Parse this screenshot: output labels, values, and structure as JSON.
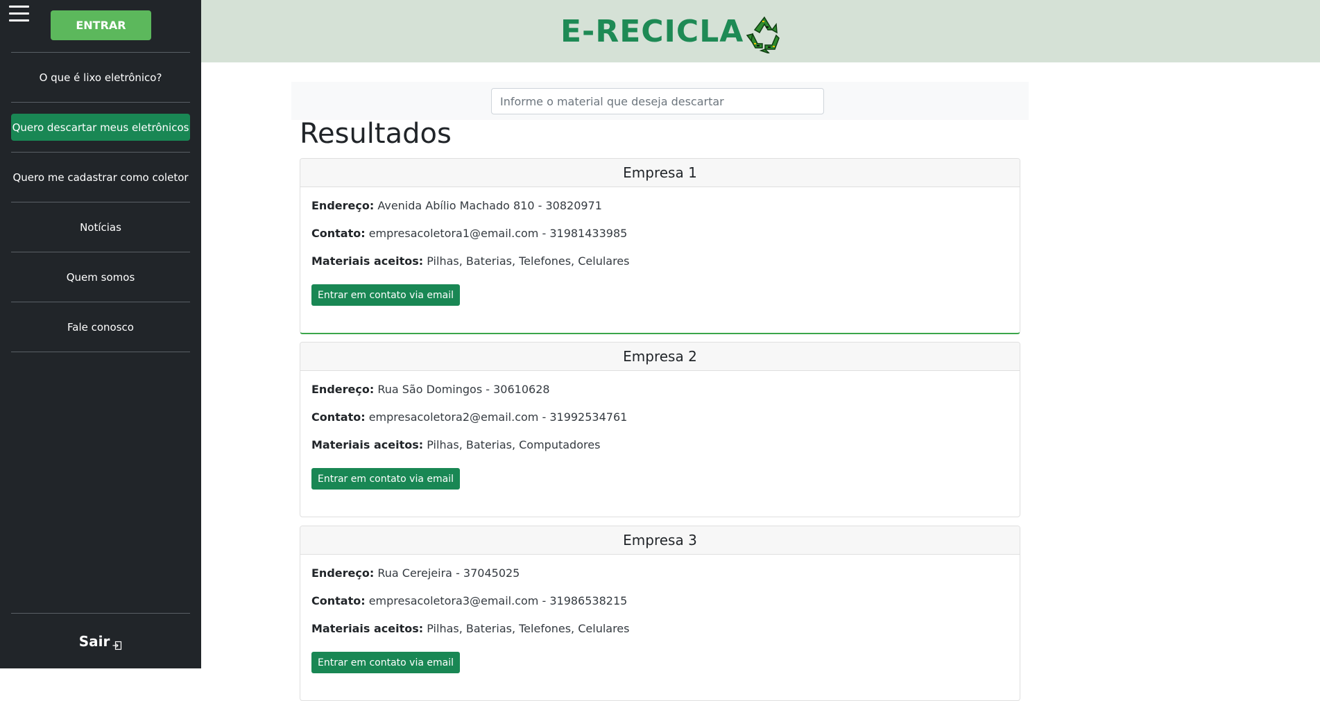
{
  "sidebar": {
    "enter_label": "ENTRAR",
    "items": [
      {
        "label": "O que é lixo eletrônico?"
      },
      {
        "label": "Quero descartar meus eletrônicos"
      },
      {
        "label": "Quero me cadastrar como coletor"
      },
      {
        "label": "Notícias"
      },
      {
        "label": "Quem somos"
      },
      {
        "label": "Fale conosco"
      }
    ],
    "active_item": "Quero descartar meus eletrônicos",
    "logout_label": "Sair"
  },
  "header": {
    "brand": "E-RECICLA"
  },
  "search": {
    "placeholder": "Informe o material que deseja descartar",
    "value": ""
  },
  "results": {
    "title": "Resultados",
    "address_label": "Endereço:",
    "contact_label": "Contato:",
    "materials_label": "Materiais aceitos:",
    "button_label": "Entrar em contato via email",
    "companies": [
      {
        "name": "Empresa 1",
        "address": "Avenida Abílio Machado 810 - 30820971",
        "contact": "empresacoletora1@email.com - 31981433985",
        "materials": "Pilhas, Baterias, Telefones, Celulares"
      },
      {
        "name": "Empresa 2",
        "address": "Rua São Domingos - 30610628",
        "contact": "empresacoletora2@email.com - 31992534761",
        "materials": "Pilhas, Baterias, Computadores"
      },
      {
        "name": "Empresa 3",
        "address": "Rua Cerejeira - 37045025",
        "contact": "empresacoletora3@email.com - 31986538215",
        "materials": "Pilhas, Baterias, Telefones, Celulares"
      }
    ]
  },
  "colors": {
    "sidebar_bg": "#212529",
    "header_bg": "#d5e1d6",
    "brand": "#1e8a55",
    "primary_button": "#198754",
    "enter_button": "#5cb85c"
  }
}
